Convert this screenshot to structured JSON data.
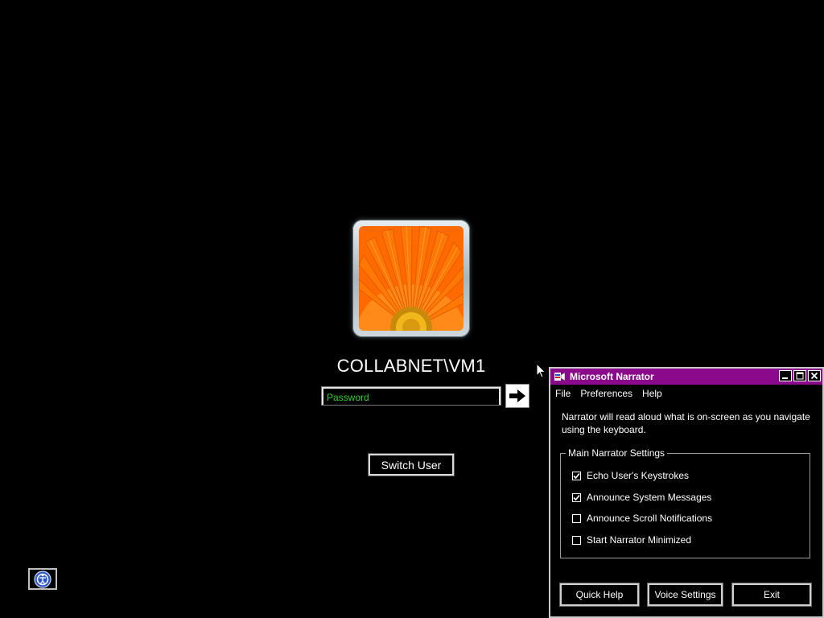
{
  "login": {
    "username": "COLLABNET\\VM1",
    "password_placeholder": "Password",
    "switch_user_label": "Switch User"
  },
  "narrator": {
    "title": "Microsoft Narrator",
    "menu": [
      "File",
      "Preferences",
      "Help"
    ],
    "description": "Narrator will read aloud what is on-screen as you navigate using the keyboard.",
    "group_title": "Main Narrator Settings",
    "options": [
      {
        "label": "Echo User's Keystrokes",
        "checked": true
      },
      {
        "label": "Announce System Messages",
        "checked": true
      },
      {
        "label": "Announce Scroll Notifications",
        "checked": false
      },
      {
        "label": "Start Narrator Minimized",
        "checked": false
      }
    ],
    "buttons": {
      "quick_help": "Quick Help",
      "voice_settings": "Voice Settings",
      "exit": "Exit"
    }
  },
  "colors": {
    "background": "#000000",
    "titlebar": "#8b0a8b",
    "password_text": "#2bd12b"
  },
  "icons": {
    "go": "arrow-right-icon",
    "ease_of_access": "ease-of-access-icon",
    "cursor": "mouse-pointer-icon"
  }
}
